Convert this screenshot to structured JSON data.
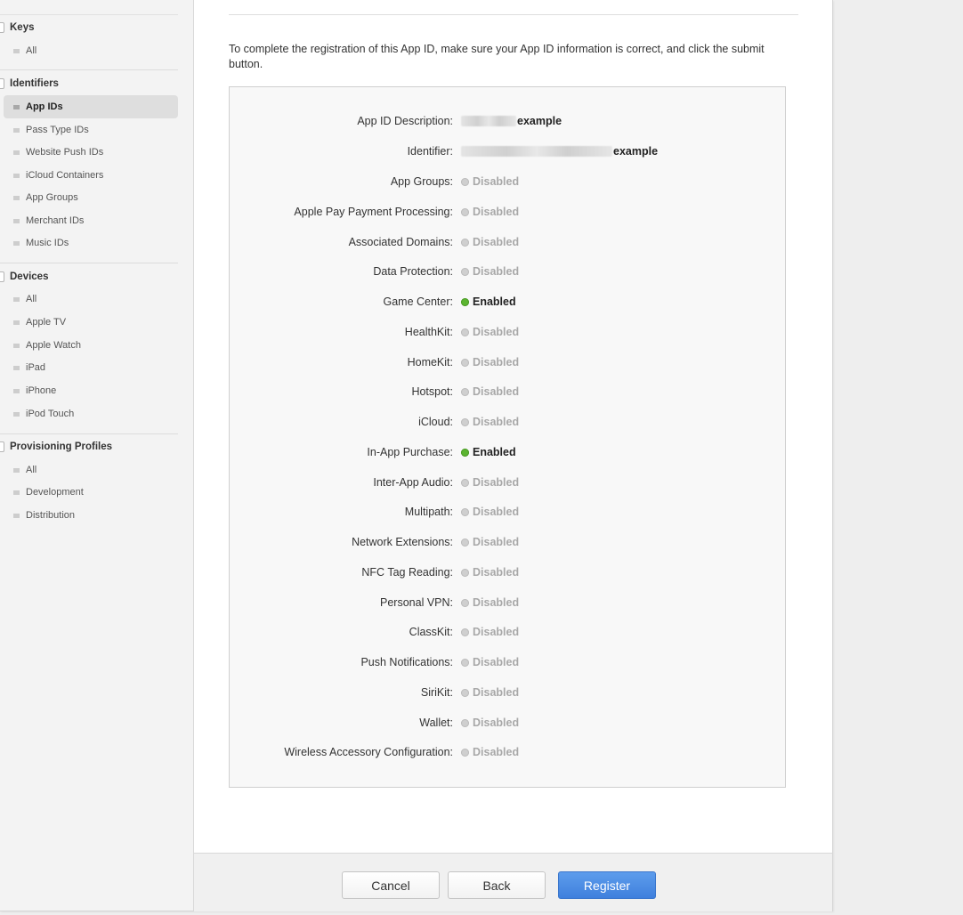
{
  "sidebar": {
    "sections": [
      {
        "title": "Keys",
        "items": [
          {
            "label": "All"
          }
        ]
      },
      {
        "title": "Identifiers",
        "items": [
          {
            "label": "App IDs",
            "active": true
          },
          {
            "label": "Pass Type IDs"
          },
          {
            "label": "Website Push IDs"
          },
          {
            "label": "iCloud Containers"
          },
          {
            "label": "App Groups"
          },
          {
            "label": "Merchant IDs"
          },
          {
            "label": "Music IDs"
          }
        ]
      },
      {
        "title": "Devices",
        "items": [
          {
            "label": "All"
          },
          {
            "label": "Apple TV"
          },
          {
            "label": "Apple Watch"
          },
          {
            "label": "iPad"
          },
          {
            "label": "iPhone"
          },
          {
            "label": "iPod Touch"
          }
        ]
      },
      {
        "title": "Provisioning Profiles",
        "items": [
          {
            "label": "All"
          },
          {
            "label": "Development"
          },
          {
            "label": "Distribution"
          }
        ]
      }
    ]
  },
  "main": {
    "intro": "To complete the registration of this App ID, make sure your App ID information is correct, and click the submit button.",
    "details": {
      "description_label": "App ID Description:",
      "description_value": "example",
      "identifier_label": "Identifier:",
      "identifier_value": "example"
    },
    "capabilities": [
      {
        "label": "App Groups:",
        "status": "Disabled",
        "enabled": false
      },
      {
        "label": "Apple Pay Payment Processing:",
        "status": "Disabled",
        "enabled": false
      },
      {
        "label": "Associated Domains:",
        "status": "Disabled",
        "enabled": false
      },
      {
        "label": "Data Protection:",
        "status": "Disabled",
        "enabled": false
      },
      {
        "label": "Game Center:",
        "status": "Enabled",
        "enabled": true
      },
      {
        "label": "HealthKit:",
        "status": "Disabled",
        "enabled": false
      },
      {
        "label": "HomeKit:",
        "status": "Disabled",
        "enabled": false
      },
      {
        "label": "Hotspot:",
        "status": "Disabled",
        "enabled": false
      },
      {
        "label": "iCloud:",
        "status": "Disabled",
        "enabled": false
      },
      {
        "label": "In-App Purchase:",
        "status": "Enabled",
        "enabled": true
      },
      {
        "label": "Inter-App Audio:",
        "status": "Disabled",
        "enabled": false
      },
      {
        "label": "Multipath:",
        "status": "Disabled",
        "enabled": false
      },
      {
        "label": "Network Extensions:",
        "status": "Disabled",
        "enabled": false
      },
      {
        "label": "NFC Tag Reading:",
        "status": "Disabled",
        "enabled": false
      },
      {
        "label": "Personal VPN:",
        "status": "Disabled",
        "enabled": false
      },
      {
        "label": "ClassKit:",
        "status": "Disabled",
        "enabled": false
      },
      {
        "label": "Push Notifications:",
        "status": "Disabled",
        "enabled": false
      },
      {
        "label": "SiriKit:",
        "status": "Disabled",
        "enabled": false
      },
      {
        "label": "Wallet:",
        "status": "Disabled",
        "enabled": false
      },
      {
        "label": "Wireless Accessory Configuration:",
        "status": "Disabled",
        "enabled": false
      }
    ]
  },
  "footer": {
    "cancel_label": "Cancel",
    "back_label": "Back",
    "register_label": "Register"
  },
  "colors": {
    "enabled": "#5cb531",
    "disabled": "#cfcfcf",
    "primary_button": "#4a8ae4"
  }
}
